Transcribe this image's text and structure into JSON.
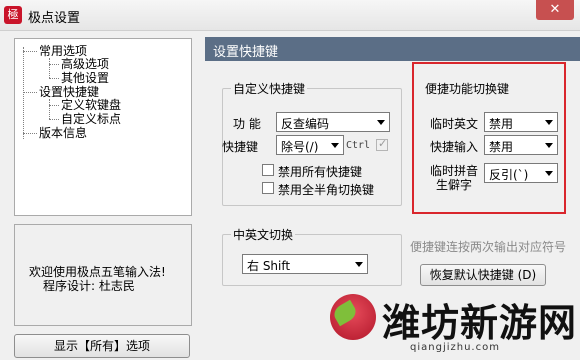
{
  "window": {
    "title": "极点设置",
    "close_glyph": "✕",
    "app_icon_glyph": "極"
  },
  "tree": {
    "items": [
      {
        "label": "常用选项"
      },
      {
        "label": "高级选项"
      },
      {
        "label": "其他设置"
      },
      {
        "label": "设置快捷键"
      },
      {
        "label": "定义软键盘"
      },
      {
        "label": "自定义标点"
      },
      {
        "label": "版本信息"
      }
    ]
  },
  "info": {
    "line1": "欢迎使用极点五笔输入法!",
    "line2": "程序设计: 杜志民"
  },
  "buttons": {
    "show_all": "显示【所有】选项",
    "restore_default": "恢复默认快捷键 (D)"
  },
  "header": {
    "title": "设置快捷键"
  },
  "custom_shortcut": {
    "group_title": "自定义快捷键",
    "function_label": "功 能",
    "function_value": "反查编码",
    "shortcut_label": "快捷键",
    "shortcut_value": "除号(/)",
    "ctrl_label": "Ctrl",
    "disable_all_label": "禁用所有快捷键",
    "disable_full_half_label": "禁用全半角切换键"
  },
  "convenience": {
    "group_title": "便捷功能切换键",
    "temp_english_label": "临时英文",
    "temp_english_value": "禁用",
    "quick_input_label": "快捷输入",
    "quick_input_value": "禁用",
    "temp_pinyin_label_1": "临时拼音",
    "temp_pinyin_label_2": "生僻字",
    "temp_pinyin_value": "反引(`)"
  },
  "cn_en_switch": {
    "group_title": "中英文切换",
    "value": "右 Shift"
  },
  "hint": "便捷键连按两次输出对应符号",
  "watermark": {
    "brand": "潍坊新游网",
    "url": "qiangjizhu.com"
  },
  "colors": {
    "header": "#5b6e86",
    "highlight": "#d9262c",
    "close": "#c75050"
  }
}
